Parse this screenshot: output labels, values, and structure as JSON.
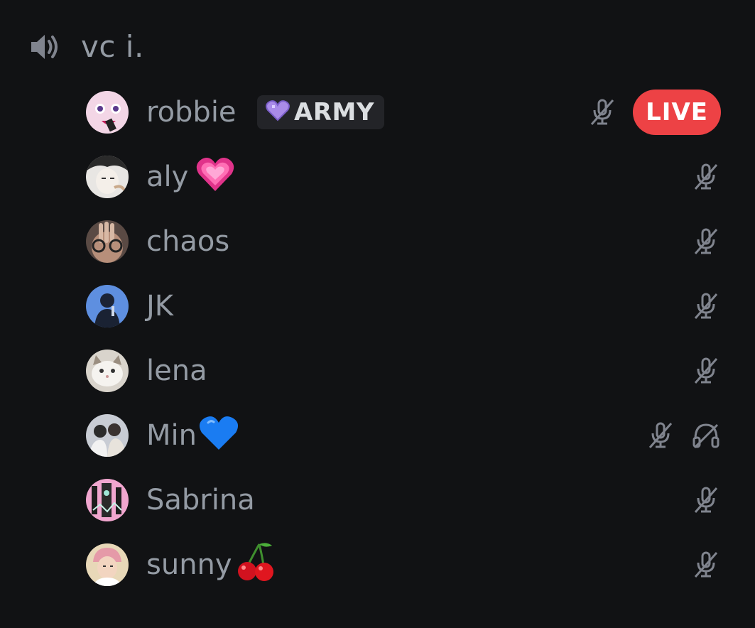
{
  "channel": {
    "name": "vc i.",
    "icon": "speaker-icon"
  },
  "users": [
    {
      "name": "robbie",
      "tag": "ARMY",
      "tag_icon": "purple-heart-icon",
      "status": [
        "mic-muted-icon"
      ],
      "live_label": "LIVE"
    },
    {
      "name": "aly",
      "emoji": "growing-pink-heart-icon",
      "status": [
        "mic-muted-icon"
      ]
    },
    {
      "name": "chaos",
      "status": [
        "mic-muted-icon"
      ]
    },
    {
      "name": "JK",
      "status": [
        "mic-muted-icon"
      ]
    },
    {
      "name": "lena",
      "status": [
        "mic-muted-icon"
      ]
    },
    {
      "name": "Min",
      "emoji": "blue-heart-icon",
      "status": [
        "mic-muted-icon",
        "headphones-deafened-icon"
      ]
    },
    {
      "name": "Sabrina",
      "status": [
        "mic-muted-icon"
      ]
    },
    {
      "name": "sunny",
      "emoji": "cherries-icon",
      "status": [
        "mic-muted-icon"
      ]
    }
  ],
  "colors": {
    "background": "#111214",
    "text_muted": "#949ba4",
    "icon_muted": "#80848e",
    "live_red": "#ed4245",
    "tag_bg": "#232428",
    "tag_text": "#dbdee1"
  }
}
